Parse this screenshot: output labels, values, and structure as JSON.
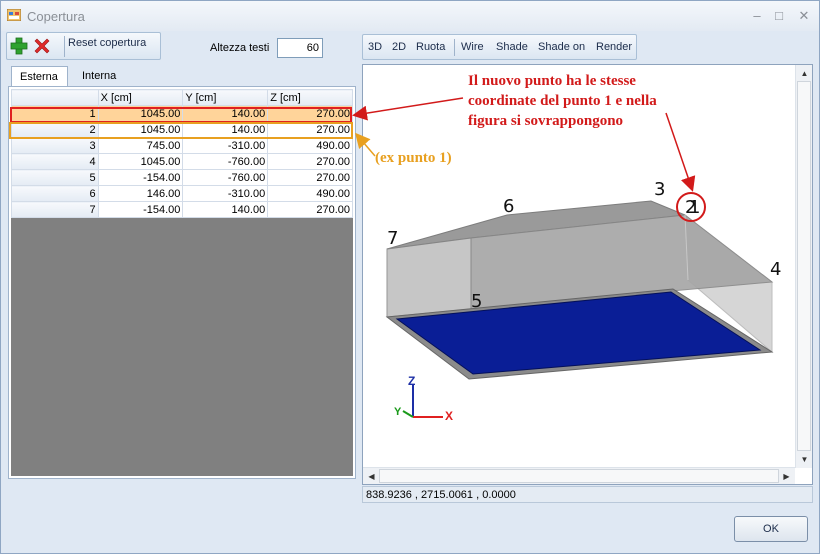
{
  "window": {
    "title": "Copertura",
    "minimize": "–",
    "maximize": "□",
    "close": "✕"
  },
  "toolbar": {
    "add_icon": "plus-icon",
    "delete_icon": "x-icon",
    "reset_label": "Reset copertura"
  },
  "text_height": {
    "label": "Altezza testi",
    "value": "60"
  },
  "view_toolbar": {
    "items": [
      "3D",
      "2D",
      "Ruota",
      "Wire",
      "Shade",
      "Shade on",
      "Render"
    ]
  },
  "tabs": [
    {
      "label": "Esterna",
      "active": true
    },
    {
      "label": "Interna",
      "active": false
    }
  ],
  "grid": {
    "columns": [
      "X [cm]",
      "Y [cm]",
      "Z [cm]"
    ],
    "rows": [
      {
        "id": "1",
        "x": "1045.00",
        "y": "140.00",
        "z": "270.00"
      },
      {
        "id": "2",
        "x": "1045.00",
        "y": "140.00",
        "z": "270.00"
      },
      {
        "id": "3",
        "x": "745.00",
        "y": "-310.00",
        "z": "490.00"
      },
      {
        "id": "4",
        "x": "1045.00",
        "y": "-760.00",
        "z": "270.00"
      },
      {
        "id": "5",
        "x": "-154.00",
        "y": "-760.00",
        "z": "270.00"
      },
      {
        "id": "6",
        "x": "146.00",
        "y": "-310.00",
        "z": "490.00"
      },
      {
        "id": "7",
        "x": "-154.00",
        "y": "140.00",
        "z": "270.00"
      }
    ]
  },
  "viewport": {
    "point_labels": {
      "p1": "1",
      "p2": "2",
      "p3": "3",
      "p4": "4",
      "p5": "5",
      "p6": "6",
      "p7": "7"
    },
    "axes": {
      "z": "Z",
      "y": "Y",
      "x": "X"
    }
  },
  "annotations": {
    "red_line1": "Il nuovo punto ha le stesse",
    "red_line2": "coordinate del punto 1  e nella",
    "red_line3": "figura si sovrappongono",
    "orange": "(ex punto 1)"
  },
  "status": {
    "coordinates": "838.9236 , 2715.0061 , 0.0000"
  },
  "ok_label": "OK",
  "colors": {
    "selection": "#ffd49a",
    "highlight_red": "#e02020",
    "highlight_orange": "#e8a020",
    "floor": "#0a1e96"
  }
}
